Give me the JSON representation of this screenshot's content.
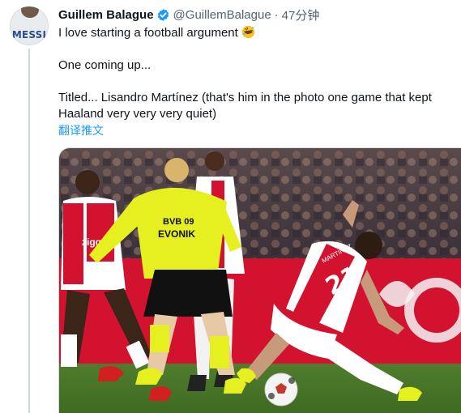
{
  "tweet": {
    "avatar_text": "MESSI",
    "author_name": "Guillem Balague",
    "handle": "@GuillemBalague",
    "time": "47分钟",
    "lines": [
      "I love starting a football argument",
      "One coming up...",
      "Titled... Lisandro Martínez (that's him in the photo one game that kept Haaland very very very quiet)"
    ],
    "translate_label": "翻译推文"
  },
  "media": {
    "shirt_sponsor": "BVB 09",
    "shirt_sponsor_2": "EVONIK",
    "ajax_sponsor": "ziggo",
    "ajax_number": "21",
    "ajax_name": "MARTINEZ"
  },
  "colors": {
    "accent": "#1d9bf0",
    "bvb_yellow": "#e6ef20",
    "ajax_red": "#d2122e"
  }
}
